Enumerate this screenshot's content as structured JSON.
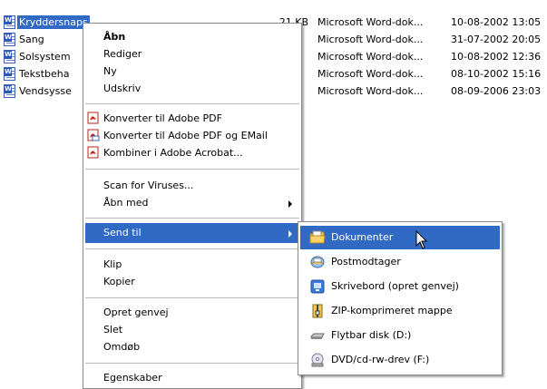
{
  "files": [
    {
      "name": "Kryddersnaps",
      "size": "21 KB",
      "type": "Microsoft Word-dok...",
      "date": "10-08-2002 13:05",
      "selected": true
    },
    {
      "name": "Sang",
      "size": "",
      "type": "Microsoft Word-dok...",
      "date": "31-07-2002 20:05",
      "selected": false
    },
    {
      "name": "Solsystem",
      "size": "",
      "type": "Microsoft Word-dok...",
      "date": "10-08-2002 12:36",
      "selected": false
    },
    {
      "name": "Tekstbeha",
      "size": "",
      "type": "Microsoft Word-dok...",
      "date": "08-10-2002 15:16",
      "selected": false
    },
    {
      "name": "Vendsysse",
      "size": "",
      "type": "Microsoft Word-dok...",
      "date": "08-09-2006 23:03",
      "selected": false
    }
  ],
  "context_menu": {
    "open": "Åbn",
    "edit": "Rediger",
    "new": "Ny",
    "print": "Udskriv",
    "convert_pdf": "Konverter til Adobe PDF",
    "convert_pdf_email": "Konverter til Adobe PDF og EMail",
    "combine_acrobat": "Kombiner i Adobe Acrobat...",
    "scan_viruses": "Scan for Viruses...",
    "open_with": "Åbn med",
    "send_to": "Send til",
    "cut": "Klip",
    "copy": "Kopier",
    "create_shortcut": "Opret genvej",
    "delete": "Slet",
    "rename": "Omdøb",
    "properties": "Egenskaber"
  },
  "send_to_menu": {
    "documents": "Dokumenter",
    "mail_recipient": "Postmodtager",
    "desktop": "Skrivebord (opret genvej)",
    "zip": "ZIP-komprimeret mappe",
    "removable": "Flytbar disk (D:)",
    "dvd": "DVD/cd-rw-drev (F:)"
  },
  "colors": {
    "selection": "#316ac5",
    "pdf_red": "#c8281e",
    "folder_yellow": "#f3c74c"
  }
}
